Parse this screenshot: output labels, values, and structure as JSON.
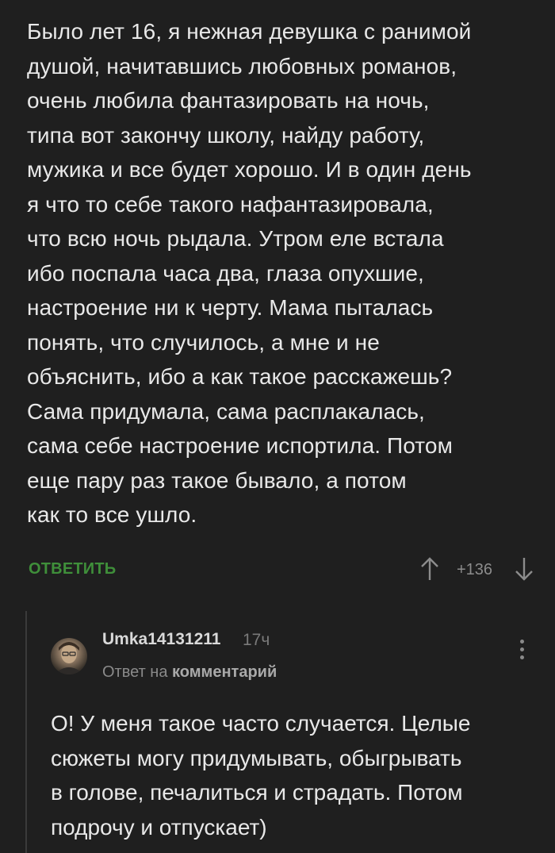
{
  "comment": {
    "lines": [
      "Было лет 16, я нежная девушка с ранимой",
      "душой, начитавшись любовных романов,",
      "очень любила фантазировать на ночь,",
      "типа вот закончу школу, найду работу,",
      "мужика и все будет хорошо. И в один день",
      "я что то себе такого нафантазировала,",
      "что всю ночь рыдала. Утром еле встала",
      "ибо поспала часа два, глаза опухшие,",
      "настроение ни к черту. Мама пыталась",
      "понять, что случилось, а мне и не",
      "объяснить, ибо а как такое расскажешь?",
      "Сама придумала, сама расплакалась,",
      "сама себе настроение испортила. Потом",
      "еще пару раз такое бывало, а потом",
      "как то все ушло."
    ],
    "reply_label": "ОТВЕТИТЬ",
    "rating": "+136",
    "up_icon": "arrow-up-icon",
    "down_icon": "arrow-down-icon"
  },
  "reply": {
    "author": "Umka14131211",
    "time": "17ч",
    "meta_prefix": "Ответ на",
    "meta_target": "комментарий",
    "avatar_icon": "avatar",
    "menu_icon": "more-vertical-icon",
    "lines": [
      "О! У меня такое часто случается. Целые",
      "сюжеты могу придумывать, обыгрывать",
      "в голове, печалиться и страдать. Потом",
      "подрочу и отпускает)"
    ]
  },
  "colors": {
    "background": "#1f1f1f",
    "text": "#e8e8e8",
    "accent_green": "#3f8f3a",
    "muted": "#8a8a8a"
  }
}
